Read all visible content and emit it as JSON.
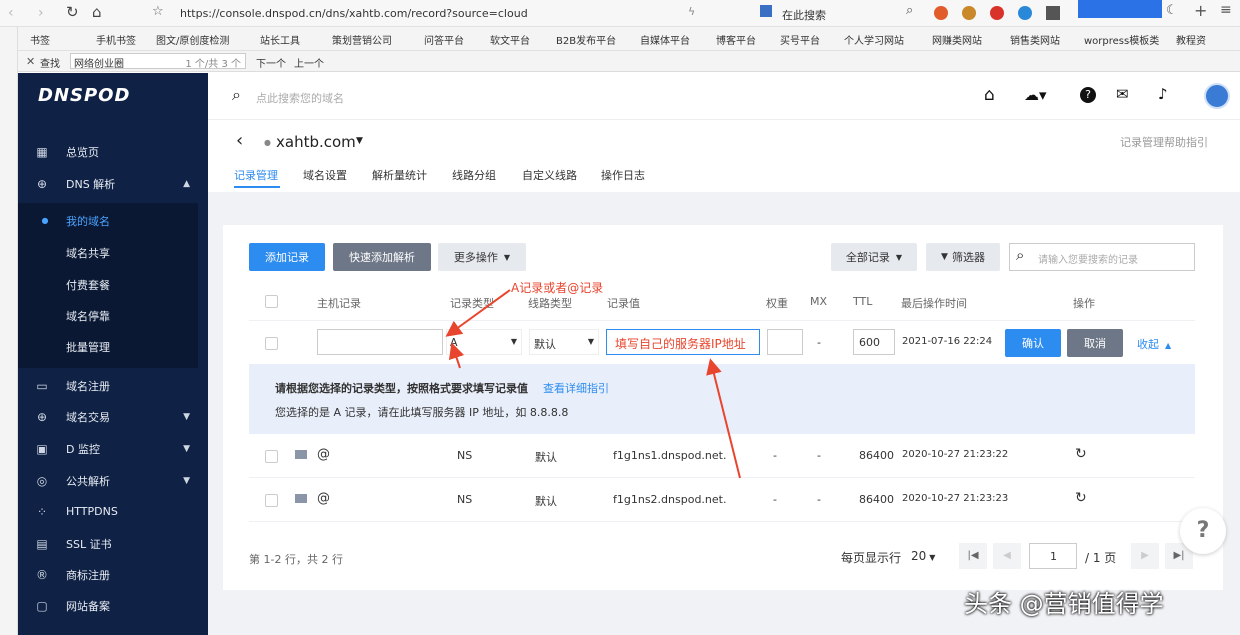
{
  "browser": {
    "url": "https://console.dnspod.cn/dns/xahtb.com/record?source=cloud",
    "search_placeholder": "在此搜索",
    "bookmarks": [
      "书签",
      "手机书签",
      "图文/原创度检测",
      "站长工具",
      "策划营销公司",
      "问答平台",
      "软文平台",
      "B2B发布平台",
      "自媒体平台",
      "博客平台",
      "买号平台",
      "个人学习网站",
      "网赚类网站",
      "销售类网站",
      "worpress模板类",
      "教程资"
    ],
    "find": {
      "label": "查找",
      "value": "网络创业圈",
      "count": "1 个/共 3 个",
      "next": "下一个",
      "prev": "上一个"
    }
  },
  "sidebar": {
    "logo": "DNSPOD",
    "items": [
      {
        "label": "总览页",
        "icon": "grid-icon"
      },
      {
        "label": "DNS 解析",
        "icon": "globe-icon",
        "chevron": "up"
      },
      {
        "label": "域名注册",
        "icon": "window-icon"
      },
      {
        "label": "域名交易",
        "icon": "globe-icon",
        "chevron": "down"
      },
      {
        "label": "D 监控",
        "icon": "monitor-icon",
        "chevron": "down"
      },
      {
        "label": "公共解析",
        "icon": "public-icon",
        "chevron": "down"
      },
      {
        "label": "HTTPDNS",
        "icon": "network-icon"
      },
      {
        "label": "SSL 证书",
        "icon": "certificate-icon"
      },
      {
        "label": "商标注册",
        "icon": "trademark-icon"
      },
      {
        "label": "网站备案",
        "icon": "filing-icon"
      }
    ],
    "sub_items": [
      "我的域名",
      "域名共享",
      "付费套餐",
      "域名停靠",
      "批量管理"
    ]
  },
  "topbar": {
    "search_placeholder": "点此搜索您的域名"
  },
  "domain": {
    "name": "xahtb.com",
    "help_link": "记录管理帮助指引",
    "tabs": [
      "记录管理",
      "域名设置",
      "解析量统计",
      "线路分组",
      "自定义线路",
      "操作日志"
    ]
  },
  "toolbar": {
    "add": "添加记录",
    "quick_add": "快速添加解析",
    "more": "更多操作",
    "all_records": "全部记录",
    "filter": "筛选器",
    "search_placeholder": "请输入您要搜索的记录"
  },
  "table": {
    "headers": [
      "主机记录",
      "记录类型",
      "线路类型",
      "记录值",
      "权重",
      "MX",
      "TTL",
      "最后操作时间",
      "操作"
    ],
    "edit_row": {
      "type": "A",
      "line": "默认",
      "value": "填写自己的服务器IP地址",
      "mx": "-",
      "ttl": "600",
      "time": "2021-07-16 22:24",
      "confirm": "确认",
      "cancel": "取消",
      "collapse": "收起"
    },
    "hint": {
      "title": "请根据您选择的记录类型，按照格式要求填写记录值",
      "link": "查看详细指引",
      "desc": "您选择的是 A 记录，请在此填写服务器 IP 地址，如 8.8.8.8"
    },
    "rows": [
      {
        "host": "@",
        "type": "NS",
        "line": "默认",
        "value": "f1g1ns1.dnspod.net.",
        "weight": "-",
        "mx": "-",
        "ttl": "86400",
        "time": "2020-10-27 21:23:22"
      },
      {
        "host": "@",
        "type": "NS",
        "line": "默认",
        "value": "f1g1ns2.dnspod.net.",
        "weight": "-",
        "mx": "-",
        "ttl": "86400",
        "time": "2020-10-27 21:23:23"
      }
    ]
  },
  "pagination": {
    "summary": "第 1-2 行，共 2 行",
    "per_page": "每页显示行",
    "per_page_value": "20",
    "page": "1",
    "total_pages": "/ 1 页"
  },
  "annotation": {
    "label": "A记录或者@记录"
  },
  "watermark": "头条 @营销值得学",
  "colors": {
    "primary": "#2d8cf0",
    "sidebar": "#0f2144",
    "annot": "#e8452e"
  }
}
